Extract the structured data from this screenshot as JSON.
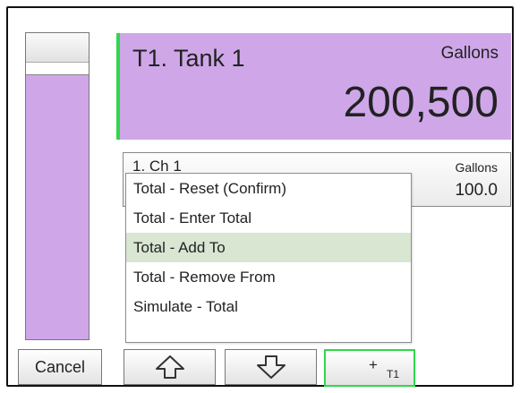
{
  "level_bar": {
    "fill_fraction": 0.86,
    "color": "#cfa7e9"
  },
  "tank": {
    "title": "T1. Tank 1",
    "unit": "Gallons",
    "value": "200,500",
    "color": "#cfa7e9",
    "accent": "#2fd84b"
  },
  "channel": {
    "title": "1. Ch 1",
    "unit": "Gallons",
    "value": "100.0"
  },
  "menu": {
    "items": [
      {
        "label": "Total - Reset (Confirm)",
        "highlighted": false
      },
      {
        "label": "Total - Enter Total",
        "highlighted": false
      },
      {
        "label": "Total - Add To",
        "highlighted": true
      },
      {
        "label": "Total - Remove From",
        "highlighted": false
      },
      {
        "label": "Simulate - Total",
        "highlighted": false
      }
    ],
    "highlight_color": "#d8e6d2"
  },
  "buttons": {
    "cancel_label": "Cancel",
    "up_icon": "arrow-up-icon",
    "down_icon": "arrow-down-icon",
    "plus_label": "+",
    "plus_sub": "T1"
  }
}
